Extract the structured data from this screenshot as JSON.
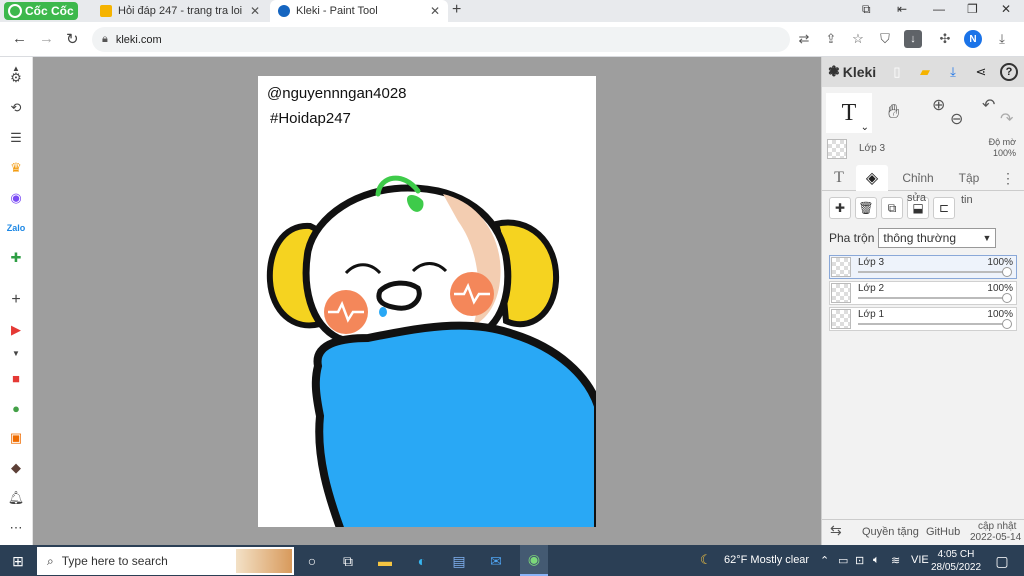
{
  "browser": {
    "brand": "Cốc Cốc",
    "tabs": [
      {
        "title": "Hỏi đáp 247 - trang tra loi",
        "favicon_color": "#f5b300",
        "close": "✕"
      },
      {
        "title": "Kleki - Paint Tool",
        "favicon_color": "#1565c0",
        "close": "✕"
      }
    ],
    "newtab": "+",
    "address": "kleki.com",
    "profile_initial": "N"
  },
  "canvas": {
    "username": "@nguyennngan4028",
    "hashtag": "#Hoidap247",
    "colors": {
      "blanket": "#29a8f5",
      "earmuffs": "#f5d320",
      "cheeks": "#f4875a",
      "skin": "#f3cdb1",
      "sprout": "#3ecb4a",
      "outline": "#111111"
    }
  },
  "kleki": {
    "logo": "Kleki",
    "current_tool": "T",
    "layer_preview": {
      "name": "Lớp 3",
      "opacity_label": "Độ mờ",
      "opacity_value": "100%"
    },
    "panel_tabs": [
      "Chỉnh",
      "Tập"
    ],
    "action_labels": {
      "edit": "sửa",
      "info": "tin"
    },
    "blend": {
      "label": "Pha trộn",
      "value": "thông thường"
    },
    "layers": [
      {
        "name": "Lớp 3",
        "opacity": "100%",
        "opacity_value": 1.0
      },
      {
        "name": "Lớp 2",
        "opacity": "100%",
        "opacity_value": 1.0
      },
      {
        "name": "Lớp 1",
        "opacity": "100%",
        "opacity_value": 1.0
      }
    ],
    "footer": {
      "privacy": "Quyền tặng",
      "github": "GitHub",
      "update_label": "cập nhật",
      "update_date": "2022-05-14"
    }
  },
  "taskbar": {
    "search_placeholder": "Type here to search",
    "weather": "62°F  Mostly clear",
    "language": "VIE",
    "time": "4:05 CH",
    "date": "28/05/2022"
  }
}
